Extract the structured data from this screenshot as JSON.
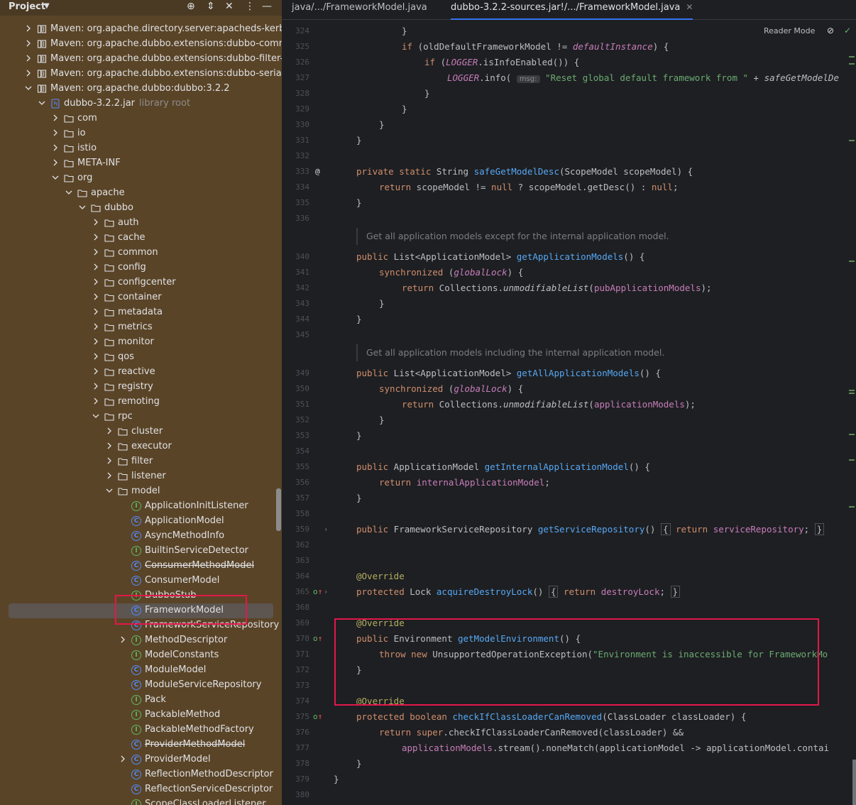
{
  "project": {
    "title": "Project",
    "header_icons": [
      "crosshair-icon",
      "expand-collapse-icon",
      "collapse-all-icon",
      "more-icon",
      "minimize-icon"
    ],
    "tree": [
      {
        "label": "Maven: org.apache.directory.server:apacheds-kerbe",
        "icon": "library-icon",
        "arrow": "right",
        "indent": 0
      },
      {
        "label": "Maven: org.apache.dubbo.extensions:dubbo-comm",
        "icon": "library-icon",
        "arrow": "right",
        "indent": 0
      },
      {
        "label": "Maven: org.apache.dubbo.extensions:dubbo-filter-s",
        "icon": "library-icon",
        "arrow": "right",
        "indent": 0
      },
      {
        "label": "Maven: org.apache.dubbo.extensions:dubbo-serializ",
        "icon": "library-icon",
        "arrow": "right",
        "indent": 0
      },
      {
        "label": "Maven: org.apache.dubbo:dubbo:3.2.2",
        "icon": "library-icon",
        "arrow": "down",
        "indent": 0
      },
      {
        "label": "dubbo-3.2.2.jar",
        "suffix": "library root",
        "icon": "jar-icon",
        "arrow": "down",
        "indent": 1
      },
      {
        "label": "com",
        "icon": "folder-icon",
        "arrow": "right",
        "indent": 2
      },
      {
        "label": "io",
        "icon": "folder-icon",
        "arrow": "right",
        "indent": 2
      },
      {
        "label": "istio",
        "icon": "folder-icon",
        "arrow": "right",
        "indent": 2
      },
      {
        "label": "META-INF",
        "icon": "folder-icon",
        "arrow": "right",
        "indent": 2
      },
      {
        "label": "org",
        "icon": "folder-icon",
        "arrow": "down",
        "indent": 2
      },
      {
        "label": "apache",
        "icon": "folder-icon",
        "arrow": "down",
        "indent": 3
      },
      {
        "label": "dubbo",
        "icon": "folder-icon",
        "arrow": "down",
        "indent": 4
      },
      {
        "label": "auth",
        "icon": "folder-icon",
        "arrow": "right",
        "indent": 5
      },
      {
        "label": "cache",
        "icon": "folder-icon",
        "arrow": "right",
        "indent": 5
      },
      {
        "label": "common",
        "icon": "folder-icon",
        "arrow": "right",
        "indent": 5
      },
      {
        "label": "config",
        "icon": "folder-icon",
        "arrow": "right",
        "indent": 5
      },
      {
        "label": "configcenter",
        "icon": "folder-icon",
        "arrow": "right",
        "indent": 5
      },
      {
        "label": "container",
        "icon": "folder-icon",
        "arrow": "right",
        "indent": 5
      },
      {
        "label": "metadata",
        "icon": "folder-icon",
        "arrow": "right",
        "indent": 5
      },
      {
        "label": "metrics",
        "icon": "folder-icon",
        "arrow": "right",
        "indent": 5
      },
      {
        "label": "monitor",
        "icon": "folder-icon",
        "arrow": "right",
        "indent": 5
      },
      {
        "label": "qos",
        "icon": "folder-icon",
        "arrow": "right",
        "indent": 5
      },
      {
        "label": "reactive",
        "icon": "folder-icon",
        "arrow": "right",
        "indent": 5
      },
      {
        "label": "registry",
        "icon": "folder-icon",
        "arrow": "right",
        "indent": 5
      },
      {
        "label": "remoting",
        "icon": "folder-icon",
        "arrow": "right",
        "indent": 5
      },
      {
        "label": "rpc",
        "icon": "folder-icon",
        "arrow": "down",
        "indent": 5
      },
      {
        "label": "cluster",
        "icon": "folder-icon",
        "arrow": "right",
        "indent": 6
      },
      {
        "label": "executor",
        "icon": "folder-icon",
        "arrow": "right",
        "indent": 6
      },
      {
        "label": "filter",
        "icon": "folder-icon",
        "arrow": "right",
        "indent": 6
      },
      {
        "label": "listener",
        "icon": "folder-icon",
        "arrow": "right",
        "indent": 6
      },
      {
        "label": "model",
        "icon": "folder-icon",
        "arrow": "down",
        "indent": 6
      },
      {
        "label": "ApplicationInitListener",
        "icon": "interface-icon",
        "indent": 7
      },
      {
        "label": "ApplicationModel",
        "icon": "class-icon",
        "indent": 7
      },
      {
        "label": "AsyncMethodInfo",
        "icon": "class-icon",
        "indent": 7
      },
      {
        "label": "BuiltinServiceDetector",
        "icon": "interface-icon",
        "indent": 7
      },
      {
        "label": "ConsumerMethodModel",
        "icon": "class-icon",
        "indent": 7,
        "strike": true
      },
      {
        "label": "ConsumerModel",
        "icon": "class-icon",
        "indent": 7
      },
      {
        "label": "DubboStub",
        "icon": "interface-icon",
        "indent": 7
      },
      {
        "label": "FrameworkModel",
        "icon": "class-icon",
        "indent": 7,
        "selected": true
      },
      {
        "label": "FrameworkServiceRepository",
        "icon": "class-icon",
        "indent": 7
      },
      {
        "label": "MethodDescriptor",
        "icon": "interface-icon",
        "arrow": "right",
        "indent": 7
      },
      {
        "label": "ModelConstants",
        "icon": "interface-icon",
        "indent": 7
      },
      {
        "label": "ModuleModel",
        "icon": "class-icon",
        "indent": 7
      },
      {
        "label": "ModuleServiceRepository",
        "icon": "class-icon",
        "indent": 7
      },
      {
        "label": "Pack",
        "icon": "interface-icon",
        "indent": 7
      },
      {
        "label": "PackableMethod",
        "icon": "interface-icon",
        "indent": 7
      },
      {
        "label": "PackableMethodFactory",
        "icon": "interface-icon",
        "indent": 7
      },
      {
        "label": "ProviderMethodModel",
        "icon": "class-icon",
        "indent": 7,
        "strike": true
      },
      {
        "label": "ProviderModel",
        "icon": "class-icon",
        "arrow": "right",
        "indent": 7
      },
      {
        "label": "ReflectionMethodDescriptor",
        "icon": "class-icon",
        "indent": 7
      },
      {
        "label": "ReflectionServiceDescriptor",
        "icon": "class-icon",
        "indent": 7
      },
      {
        "label": "ScopeClassLoaderListener",
        "icon": "interface-icon",
        "indent": 7
      }
    ]
  },
  "editor": {
    "tabs": [
      {
        "label": "java/.../FrameworkModel.java",
        "active": false
      },
      {
        "label": "dubbo-3.2.2-sources.jar!/.../FrameworkModel.java",
        "active": true
      }
    ],
    "reader_mode_label": "Reader Mode",
    "lines": [
      {
        "num": "324",
        "indent": 2,
        "html": "}"
      },
      {
        "num": "325",
        "indent": 2,
        "html": "<span class='kw'>if</span> (oldDefaultFrameworkModel != <span class='sfi'>defaultInstance</span>) {"
      },
      {
        "num": "326",
        "indent": 3,
        "html": "<span class='kw'>if</span> (<span class='sfi'>LOGGER</span>.isInfoEnabled()) {"
      },
      {
        "num": "327",
        "indent": 4,
        "html": "<span class='sfi'>LOGGER</span>.info( <span class='hint'>msg:</span> <span class='str'>\"Reset global default framework from \"</span> + <span class='mi'>safeGetModelDe</span>"
      },
      {
        "num": "328",
        "indent": 3,
        "html": "}"
      },
      {
        "num": "329",
        "indent": 2,
        "html": "}"
      },
      {
        "num": "330",
        "indent": 1,
        "html": "}"
      },
      {
        "num": "331",
        "indent": 0,
        "html": "}"
      },
      {
        "num": "332",
        "indent": 0,
        "html": ""
      },
      {
        "num": "333",
        "indent": 0,
        "gutter": "@",
        "html": "<span class='kw'>private static</span> String <span class='fn'>safeGetModelDesc</span>(ScopeModel scopeModel) {"
      },
      {
        "num": "334",
        "indent": 1,
        "html": "<span class='kw'>return</span> scopeModel != <span class='kw'>null</span> ? scopeModel.getDesc() : <span class='kw'>null</span>;"
      },
      {
        "num": "335",
        "indent": 0,
        "html": "}"
      },
      {
        "num": "336",
        "indent": 0,
        "html": ""
      },
      {
        "num": "",
        "doc": "Get all application models except for the internal application model."
      },
      {
        "num": "340",
        "indent": 0,
        "html": "<span class='kw'>public</span> List&lt;ApplicationModel&gt; <span class='fn'>getApplicationModels</span>() {"
      },
      {
        "num": "341",
        "indent": 1,
        "html": "<span class='kw'>synchronized</span> (<span class='fldi'>globalLock</span>) {"
      },
      {
        "num": "342",
        "indent": 2,
        "html": "<span class='kw'>return</span> Collections.<span class='mi'>unmodifiableList</span>(<span class='fld'>pubApplicationModels</span>);"
      },
      {
        "num": "343",
        "indent": 1,
        "html": "}"
      },
      {
        "num": "344",
        "indent": 0,
        "html": "}"
      },
      {
        "num": "345",
        "indent": 0,
        "html": ""
      },
      {
        "num": "",
        "doc": "Get all application models including the internal application model."
      },
      {
        "num": "349",
        "indent": 0,
        "html": "<span class='kw'>public</span> List&lt;ApplicationModel&gt; <span class='fn'>getAllApplicationModels</span>() {"
      },
      {
        "num": "350",
        "indent": 1,
        "html": "<span class='kw'>synchronized</span> (<span class='fldi'>globalLock</span>) {"
      },
      {
        "num": "351",
        "indent": 2,
        "html": "<span class='kw'>return</span> Collections.<span class='mi'>unmodifiableList</span>(<span class='fld'>applicationModels</span>);"
      },
      {
        "num": "352",
        "indent": 1,
        "html": "}"
      },
      {
        "num": "353",
        "indent": 0,
        "html": "}"
      },
      {
        "num": "354",
        "indent": 0,
        "html": ""
      },
      {
        "num": "355",
        "indent": 0,
        "html": "<span class='kw'>public</span> ApplicationModel <span class='fn'>getInternalApplicationModel</span>() {"
      },
      {
        "num": "356",
        "indent": 1,
        "html": "<span class='kw'>return</span> <span class='fld'>internalApplicationModel</span>;"
      },
      {
        "num": "357",
        "indent": 0,
        "html": "}"
      },
      {
        "num": "358",
        "indent": 0,
        "html": ""
      },
      {
        "num": "359",
        "indent": 0,
        "gutter": "fold",
        "html": "<span class='kw'>public</span> FrameworkServiceRepository <span class='fn'>getServiceRepository</span>() <span class='fold-box'>{</span> <span class='kw'>return</span> <span class='fld'>serviceRepository</span>; <span class='fold-box'>}</span>"
      },
      {
        "num": "362",
        "indent": 0,
        "html": ""
      },
      {
        "num": "363",
        "indent": 0,
        "html": ""
      },
      {
        "num": "364",
        "indent": 0,
        "html": "<span class='ann'>@Override</span>"
      },
      {
        "num": "365",
        "indent": 0,
        "gutter": "override-fold",
        "html": "<span class='kw'>protected</span> Lock <span class='fn'>acquireDestroyLock</span>() <span class='fold-box'>{</span> <span class='kw'>return</span> <span class='fld'>destroyLock</span>; <span class='fold-box'>}</span>"
      },
      {
        "num": "368",
        "indent": 0,
        "html": ""
      },
      {
        "num": "369",
        "indent": 0,
        "html": "<span class='ann'>@Override</span>"
      },
      {
        "num": "370",
        "indent": 0,
        "gutter": "override",
        "html": "<span class='kw'>public</span> Environment <span class='fn'>getModelEnvironment</span>() {"
      },
      {
        "num": "371",
        "indent": 1,
        "html": "<span class='kw'>throw new</span> UnsupportedOperationException(<span class='str'>\"Environment is inaccessible for FrameworkMo</span>"
      },
      {
        "num": "372",
        "indent": 0,
        "html": "}"
      },
      {
        "num": "373",
        "indent": 0,
        "html": ""
      },
      {
        "num": "374",
        "indent": 0,
        "html": "<span class='ann'>@Override</span>"
      },
      {
        "num": "375",
        "indent": 0,
        "gutter": "override",
        "html": "<span class='kw'>protected boolean</span> <span class='fn'>checkIfClassLoaderCanRemoved</span>(ClassLoader classLoader) {"
      },
      {
        "num": "376",
        "indent": 1,
        "html": "<span class='kw'>return super</span>.checkIfClassLoaderCanRemoved(classLoader) &amp;&amp;"
      },
      {
        "num": "377",
        "indent": 2,
        "html": "<span class='fld'>applicationModels</span>.stream().noneMatch(applicationModel -&gt; applicationModel.contai"
      },
      {
        "num": "378",
        "indent": 0,
        "html": "}"
      },
      {
        "num": "379",
        "indent": -1,
        "html": "}"
      },
      {
        "num": "380",
        "indent": 0,
        "html": ""
      }
    ]
  },
  "colors": {
    "panel_bg": "#5a4427",
    "editor_bg": "#1e1f22",
    "highlight_box": "#e2174a",
    "keyword": "#cf8e6d",
    "method": "#56a8f5",
    "string": "#6aab73",
    "field": "#c77dbb"
  }
}
